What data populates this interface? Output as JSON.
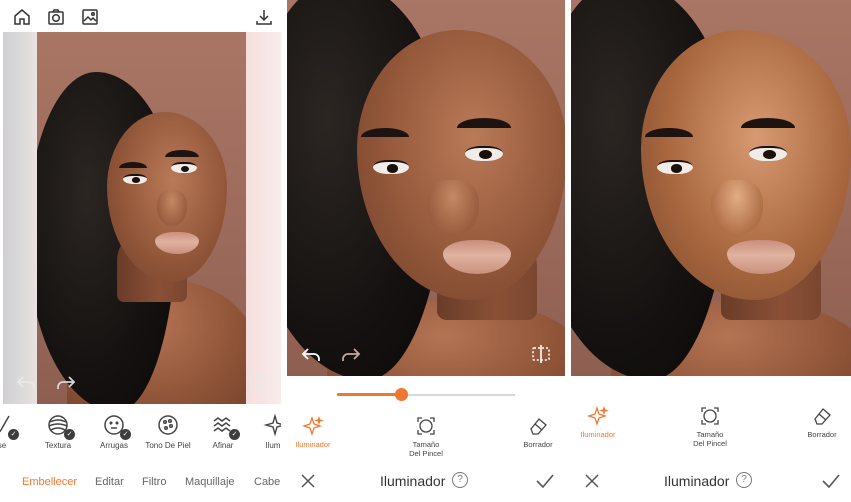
{
  "colors": {
    "accent": "#f0772f",
    "text": "#333333",
    "muted": "#666666"
  },
  "panel1": {
    "top_icons": [
      "home-icon",
      "camera-icon",
      "gallery-icon",
      "download-icon"
    ],
    "tools": [
      {
        "label": "se",
        "icon": "brush-icon",
        "checked": true
      },
      {
        "label": "Textura",
        "icon": "texture-icon",
        "checked": true
      },
      {
        "label": "Arrugas",
        "icon": "wrinkles-icon",
        "checked": true
      },
      {
        "label": "Tono De Piel",
        "icon": "skin-tone-icon",
        "checked": false
      },
      {
        "label": "Afinar",
        "icon": "sharpen-icon",
        "checked": true
      },
      {
        "label": "Ilumin",
        "icon": "sparkle-icon",
        "checked": false
      }
    ],
    "tabs": [
      "Embellecer",
      "Editar",
      "Filtro",
      "Maquillaje",
      "Cabe"
    ],
    "active_tab": "Embellecer"
  },
  "panel2": {
    "slider_value": 0.36,
    "tools": [
      "Iluminador",
      "Tamaño\nDel Pincel",
      "Borrador"
    ],
    "title": "Iluminador"
  },
  "panel3": {
    "tools": [
      "Iluminador",
      "Tamaño\nDel Pincel",
      "Borrador"
    ],
    "title": "Iluminador"
  }
}
